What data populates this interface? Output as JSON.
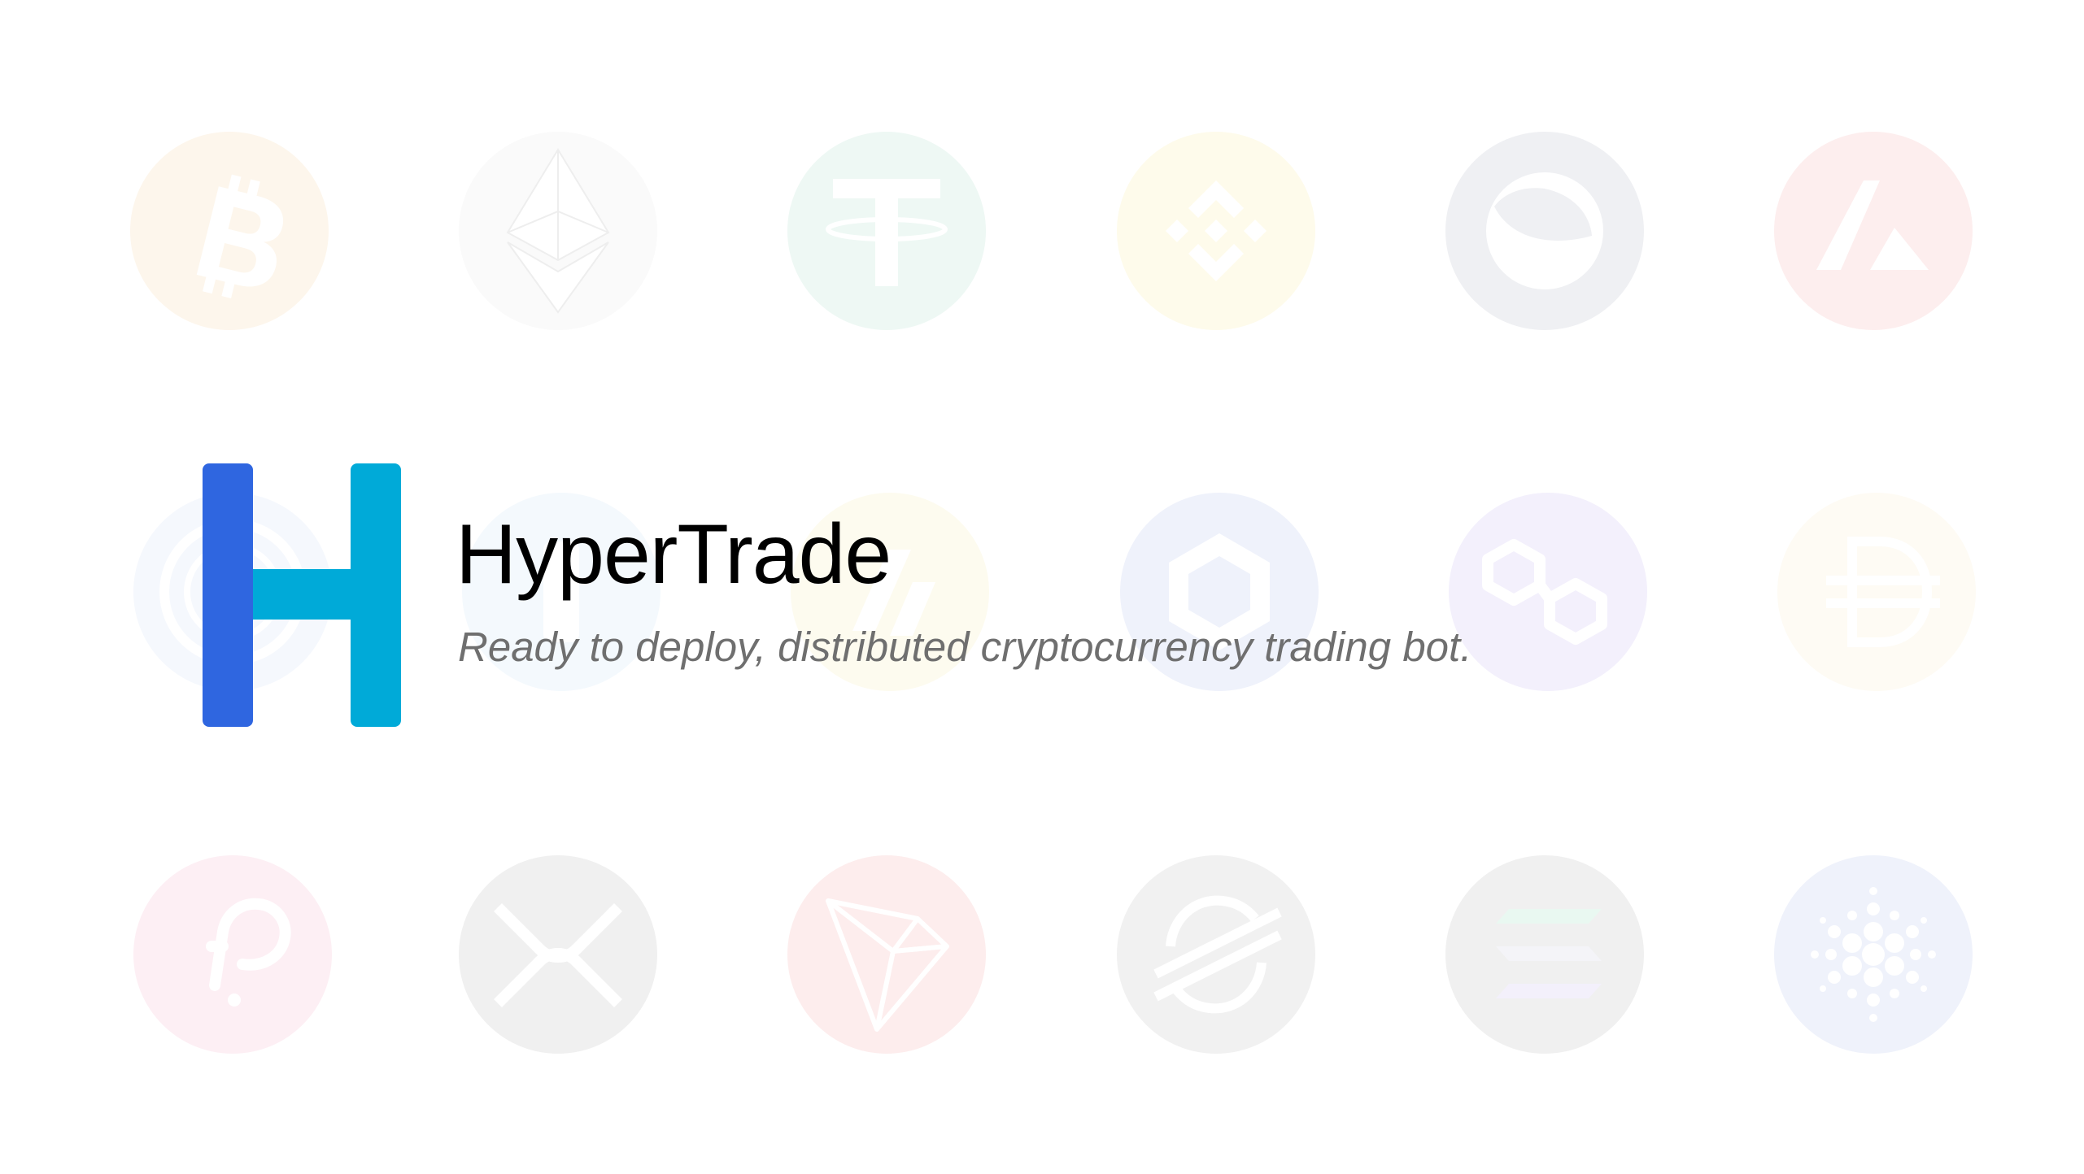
{
  "brand": {
    "name": "HyperTrade",
    "tagline": "Ready to deploy, distributed cryptocurrency trading bot.",
    "logo_colors": {
      "left_bar": "#2f66e0",
      "right_bar": "#00aad8"
    }
  },
  "background_icons": [
    {
      "icon": "bitcoin-icon",
      "color": "#fdf6ec"
    },
    {
      "icon": "ethereum-icon",
      "color": "#fafafa"
    },
    {
      "icon": "tether-icon",
      "color": "#eef8f4"
    },
    {
      "icon": "binance-coin-icon",
      "color": "#fefbeb"
    },
    {
      "icon": "terra-luna-icon",
      "color": "#eff0f3"
    },
    {
      "icon": "avalanche-icon",
      "color": "#fdeeee"
    },
    {
      "icon": "usd-coin-icon",
      "color": "#f5f8fd"
    },
    {
      "icon": "terrausd-icon",
      "color": "#f4f9fd"
    },
    {
      "icon": "dai-icon",
      "color": "#fdfbef"
    },
    {
      "icon": "chainlink-icon",
      "color": "#eff2fb"
    },
    {
      "icon": "polygon-icon",
      "color": "#f3f0fc"
    },
    {
      "icon": "stablecoin-dollar-icon",
      "color": "#fefbf4"
    },
    {
      "icon": "polkadot-icon",
      "color": "#fdeff4"
    },
    {
      "icon": "xrp-icon",
      "color": "#f0f0f0"
    },
    {
      "icon": "tron-icon",
      "color": "#fdeded"
    },
    {
      "icon": "stellar-icon",
      "color": "#f1f1f1"
    },
    {
      "icon": "solana-icon",
      "color": "#f0f0f0"
    },
    {
      "icon": "cardano-icon",
      "color": "#eff2fb"
    }
  ]
}
